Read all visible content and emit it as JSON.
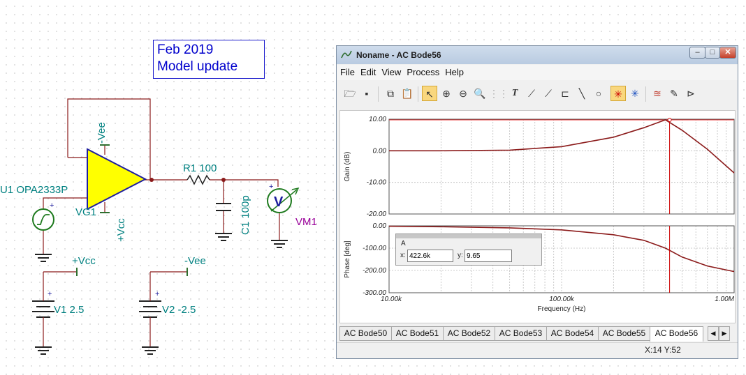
{
  "schematic": {
    "note_line1": "Feb 2019",
    "note_line2": "Model update",
    "opamp_name": "U1 OPA2333P",
    "opamp_neg_pin": "-Vee",
    "opamp_pos_pin": "+Vcc",
    "source_name": "VG1",
    "r1_label": "R1 100",
    "c1_label": "C1 100p",
    "meter_name": "VM1",
    "meter_symbol": "V",
    "vcc_label": "+Vcc",
    "vee_label": "-Vee",
    "v1_label": "V1 2.5",
    "v2_label": "V2 -2.5",
    "plus": "+",
    "opamp_color": "#ffff00",
    "wire_color": "#8b1a1a",
    "text_color": "#008080"
  },
  "window": {
    "title": "Noname - AC Bode56",
    "menu": [
      "File",
      "Edit",
      "View",
      "Process",
      "Help"
    ],
    "status": "X:14  Y:52",
    "tabs": [
      "AC Bode50",
      "AC Bode51",
      "AC Bode52",
      "AC Bode53",
      "AC Bode54",
      "AC Bode55",
      "AC Bode56"
    ],
    "active_tab": "AC Bode56",
    "cursor": {
      "name": "A",
      "x_label": "x:",
      "x_value": "422.6k",
      "y_label": "y:",
      "y_value": "9.65"
    },
    "toolbar_icons": [
      "open-icon",
      "save-icon",
      "copy-icon",
      "paste-icon",
      "pointer-icon",
      "zoom-in-icon",
      "zoom-out-icon",
      "zoom-100-icon",
      "grid-icon",
      "text-tool-icon",
      "line-tool-icon",
      "curve-tool-icon",
      "axis-tool-icon",
      "line-icon",
      "circle-icon",
      "cursor-a-icon",
      "cursor-b-icon",
      "curve-edit-icon",
      "eyedropper-icon",
      "flag-icon"
    ]
  },
  "chart_data": [
    {
      "type": "line",
      "ylabel": "Gain (dB)",
      "yticks": [
        "10.00",
        "0.00",
        "-10.00",
        "-20.00"
      ],
      "ylim": [
        -20,
        10
      ],
      "xscale": "log",
      "xlim": [
        10000,
        1000000
      ],
      "x": [
        10000,
        20000,
        50000,
        100000,
        200000,
        300000,
        400000,
        500000,
        700000,
        1000000
      ],
      "series": [
        {
          "values": [
            0,
            0,
            0.2,
            1.3,
            4.3,
            7.3,
            9.8,
            6.5,
            0.5,
            -7
          ]
        }
      ],
      "color": "#8b1a1a"
    },
    {
      "type": "line",
      "ylabel": "Phase [deg]",
      "yticks": [
        "0.00",
        "-100.00",
        "-200.00",
        "-300.00"
      ],
      "ylim": [
        -300,
        0
      ],
      "xscale": "log",
      "xlim": [
        10000,
        1000000
      ],
      "xlabel": "Frequency (Hz)",
      "xticks": [
        "10.00k",
        "100.00k",
        "1.00M"
      ],
      "x": [
        10000,
        20000,
        50000,
        100000,
        200000,
        300000,
        400000,
        500000,
        700000,
        1000000
      ],
      "series": [
        {
          "values": [
            -2,
            -4,
            -9,
            -18,
            -40,
            -65,
            -100,
            -140,
            -180,
            -205
          ]
        }
      ],
      "color": "#8b1a1a"
    }
  ]
}
